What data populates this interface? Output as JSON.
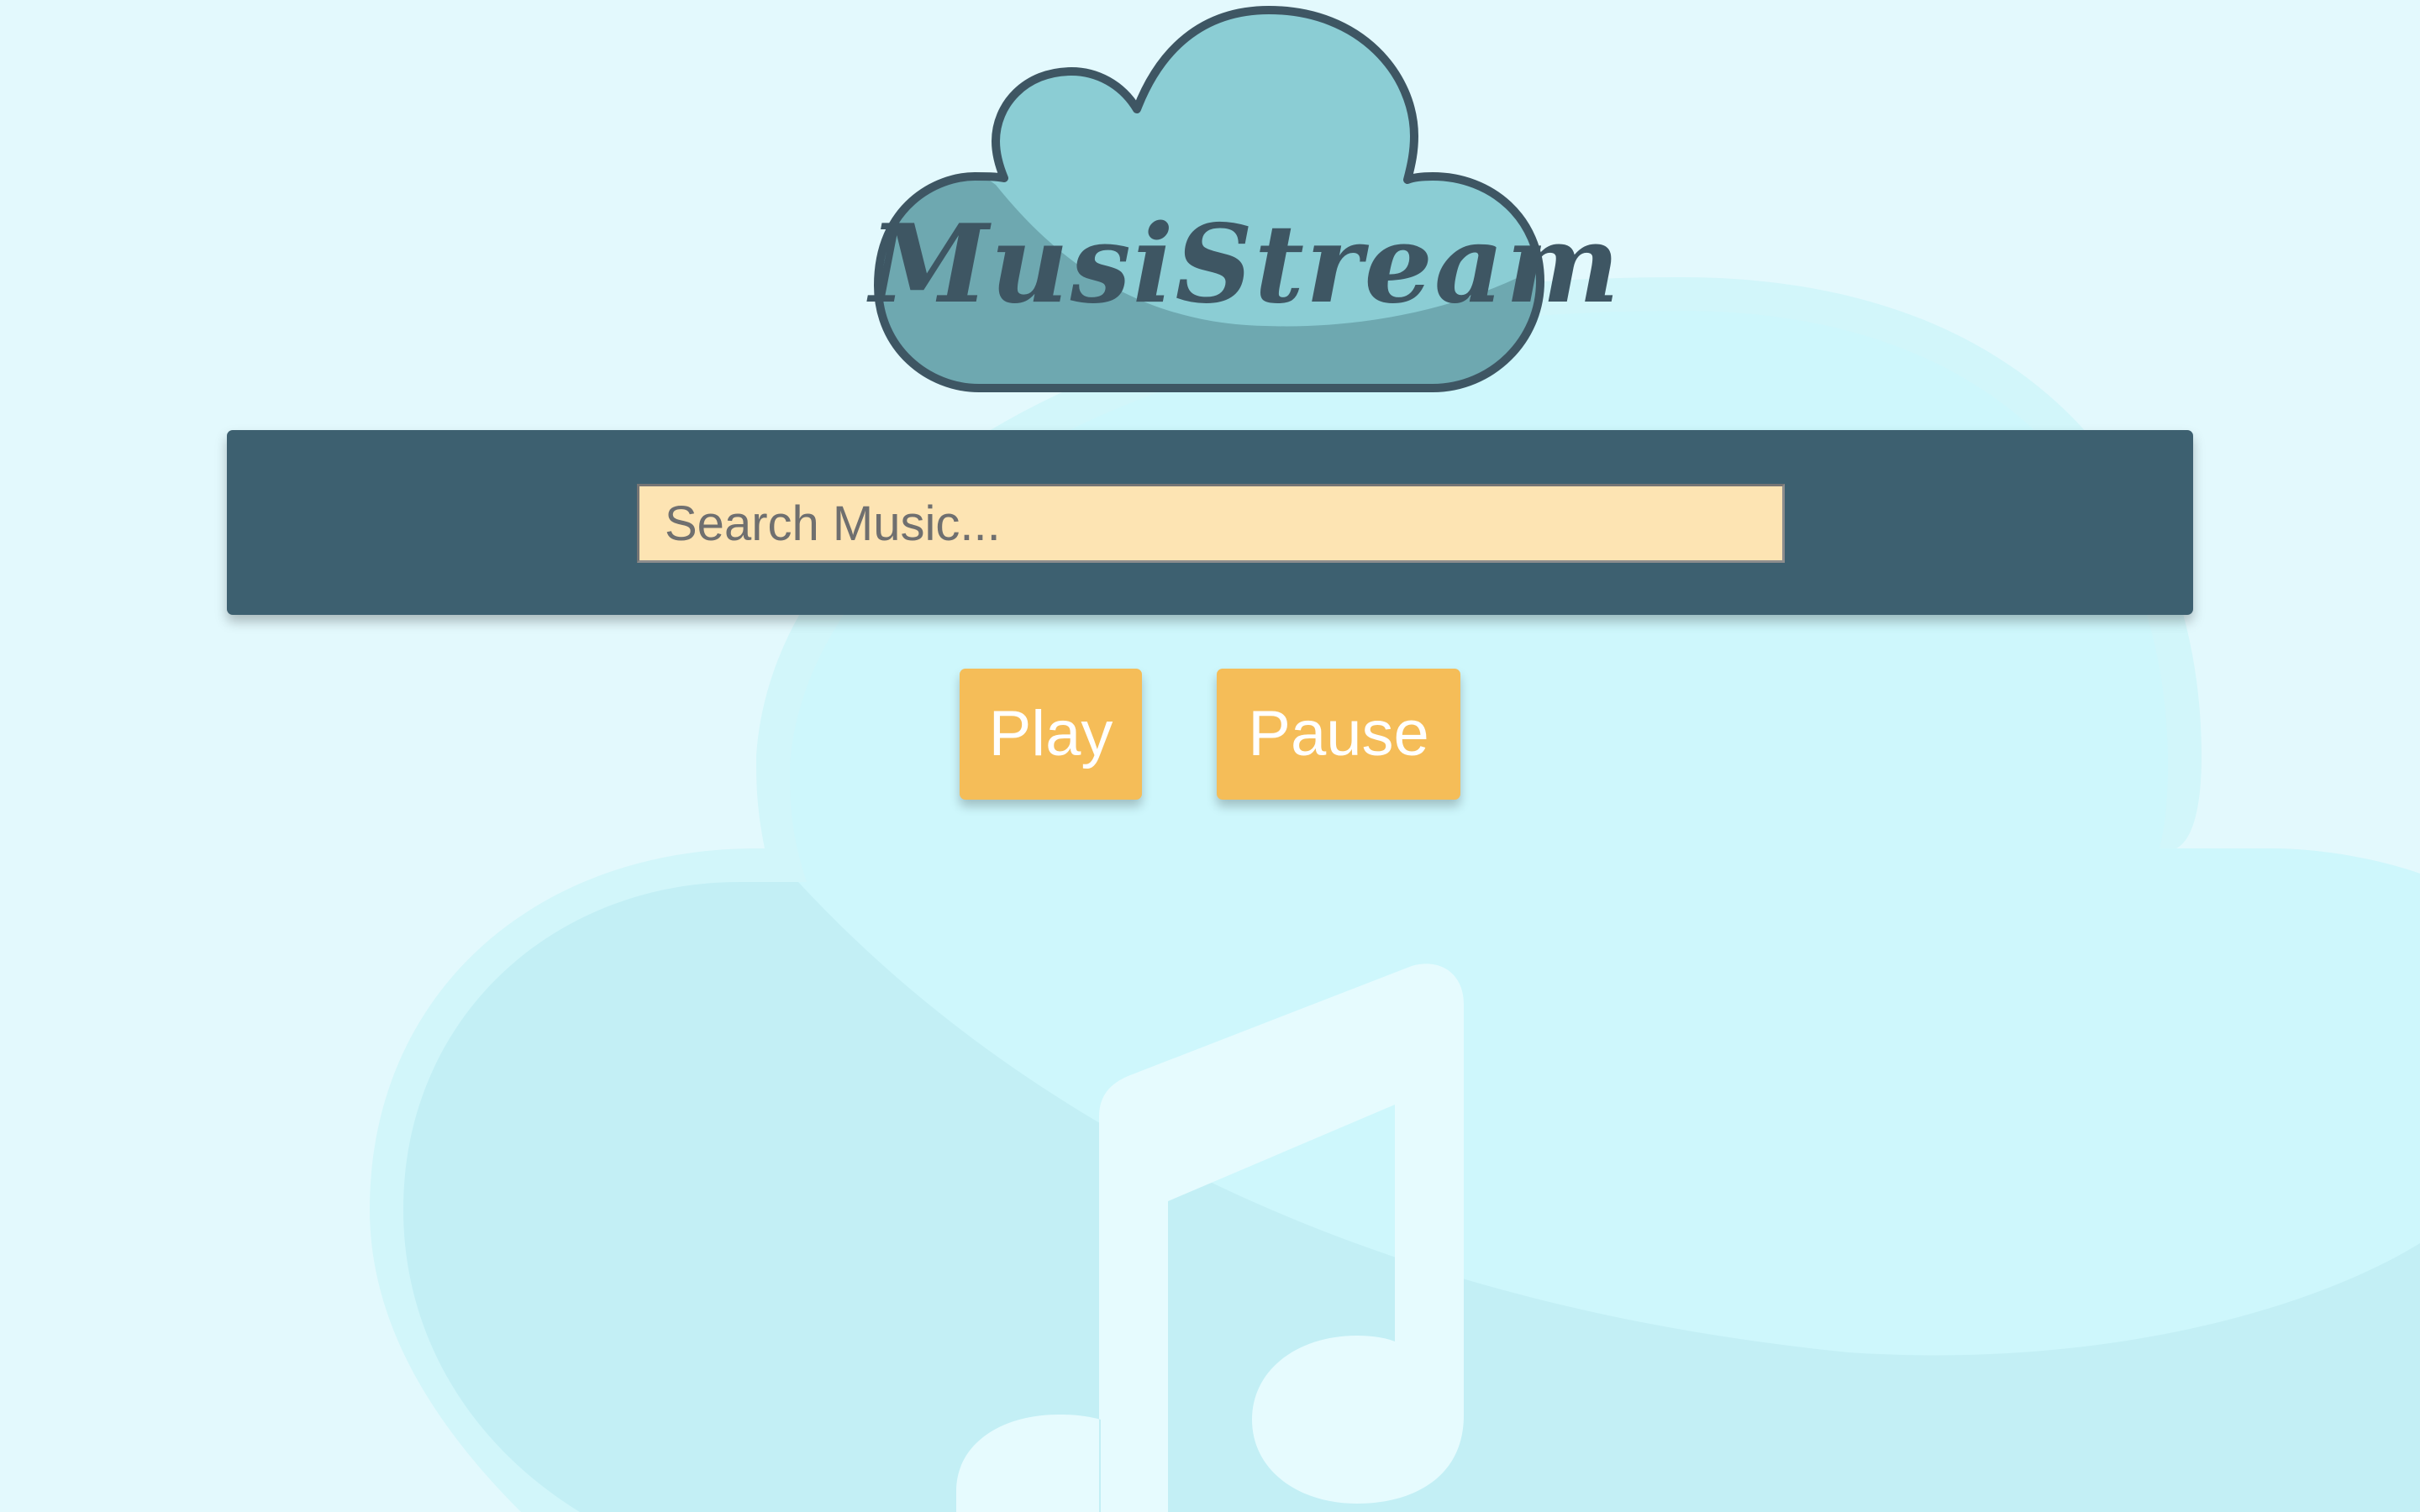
{
  "app": {
    "logo_text": "MusiStream"
  },
  "search": {
    "placeholder": "Search Music...",
    "value": ""
  },
  "controls": {
    "play_label": "Play",
    "pause_label": "Pause"
  },
  "icons": {
    "background_cloud": "cloud-icon",
    "background_note": "music-note-icon",
    "logo_cloud": "cloud-icon"
  },
  "colors": {
    "page_background": "#e3f9fd",
    "search_bar": "#3d6070",
    "search_input": "#fde4b3",
    "button": "#f5bd58",
    "button_text": "#ffffff",
    "logo_cloud_light": "#8bcdd4",
    "logo_cloud_dark": "#6ea8b0",
    "logo_outline": "#3e5663"
  }
}
